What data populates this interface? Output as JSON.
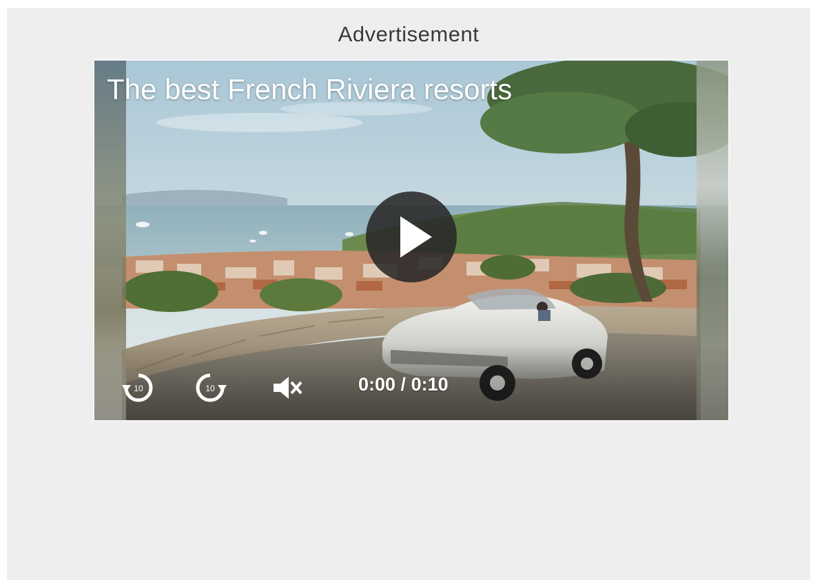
{
  "ad": {
    "label": "Advertisement"
  },
  "video": {
    "title": "The best French Riviera resorts",
    "current_time": "0:00",
    "separator": " / ",
    "duration": "0:10",
    "rewind_seconds": "10",
    "forward_seconds": "10",
    "controls": {
      "play_icon": "play-icon",
      "rewind_icon": "rewind-10-icon",
      "forward_icon": "forward-10-icon",
      "mute_icon": "speaker-muted-icon"
    }
  },
  "colors": {
    "panel_background": "#eeeeee",
    "label_text": "#3a3a3a",
    "play_button_background": "#282828",
    "overlay_text": "#ffffff"
  }
}
